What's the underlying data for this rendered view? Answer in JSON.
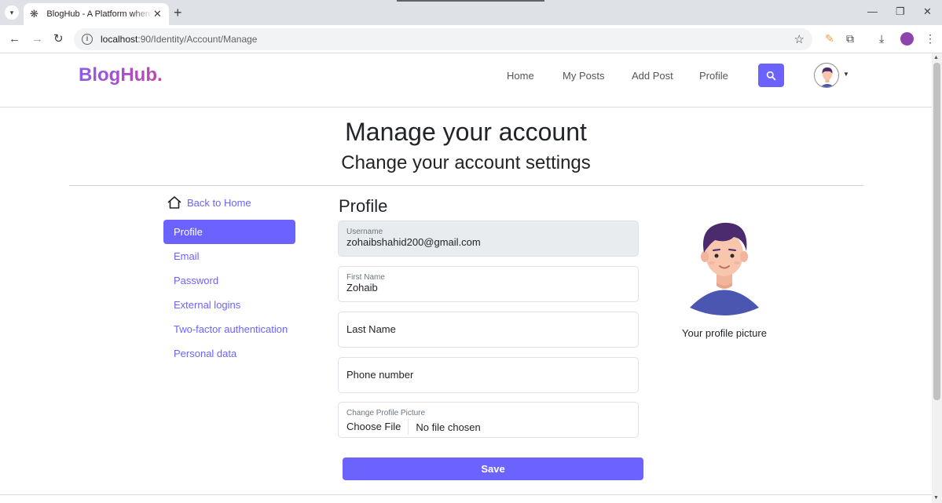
{
  "browser": {
    "tab_title": "BlogHub - A Platform where you",
    "url_host": "localhost",
    "url_rest": ":90/Identity/Account/Manage",
    "new_tab": "+",
    "tab_close": "✕"
  },
  "header": {
    "brand": "BlogHub.",
    "nav": [
      "Home",
      "My Posts",
      "Add Post",
      "Profile"
    ]
  },
  "page": {
    "title": "Manage your account",
    "subtitle": "Change your account settings"
  },
  "sidebar": {
    "back_label": "Back to Home",
    "items": [
      {
        "label": "Profile",
        "active": true
      },
      {
        "label": "Email"
      },
      {
        "label": "Password"
      },
      {
        "label": "External logins"
      },
      {
        "label": "Two-factor authentication"
      },
      {
        "label": "Personal data"
      }
    ]
  },
  "form": {
    "section_title": "Profile",
    "username_label": "Username",
    "username_value": "zohaibshahid200@gmail.com",
    "first_name_label": "First Name",
    "first_name_value": "Zohaib",
    "last_name_placeholder": "Last Name",
    "phone_placeholder": "Phone number",
    "picture_label": "Change Profile Picture",
    "choose_file": "Choose File",
    "no_file": "No file chosen",
    "save_label": "Save"
  },
  "profile_picture": {
    "caption": "Your profile picture"
  },
  "colors": {
    "accent": "#6c63ff",
    "brand_gradient_start": "#8e5be8",
    "brand_gradient_end": "#c048a8"
  }
}
